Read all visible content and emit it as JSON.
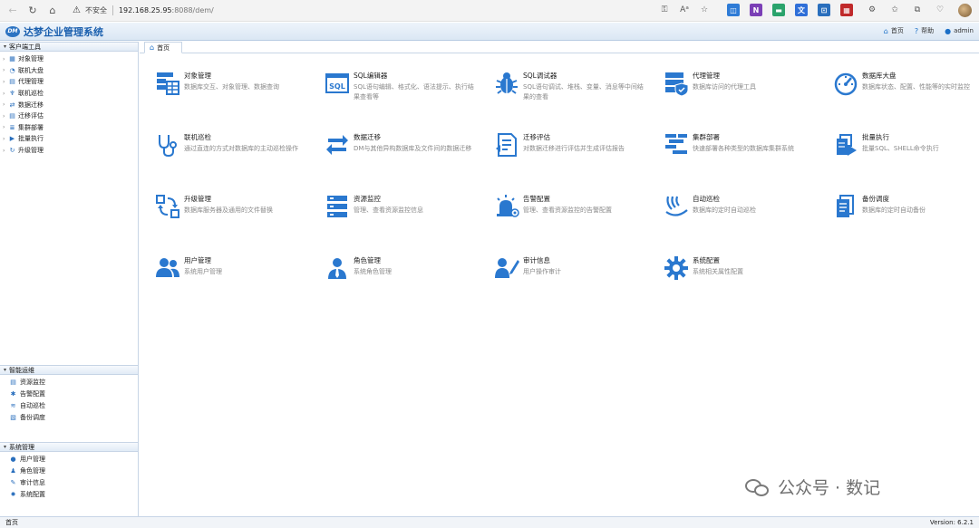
{
  "browser": {
    "insecure_label": "不安全",
    "url_host": "192.168.25.95",
    "url_path": ":8088/dem/",
    "extensions": [
      {
        "name": "screenshot-ext",
        "color": "#2e7bd6",
        "glyph": "◫"
      },
      {
        "name": "onenote-ext",
        "color": "#7b3fb6",
        "glyph": "N"
      },
      {
        "name": "reader-ext",
        "color": "#2aa36b",
        "glyph": "▬"
      },
      {
        "name": "translate-ext",
        "color": "#2f6fd8",
        "glyph": "文"
      },
      {
        "name": "crop-ext",
        "color": "#2a6fbd",
        "glyph": "⊡"
      },
      {
        "name": "pdf-ext",
        "color": "#c0292a",
        "glyph": "▦"
      }
    ]
  },
  "header": {
    "title": "达梦企业管理系统",
    "logo_text": "DM",
    "links": [
      {
        "name": "home",
        "label": "首页",
        "icon": "⌂"
      },
      {
        "name": "help",
        "label": "帮助",
        "icon": "?"
      },
      {
        "name": "user",
        "label": "admin",
        "icon": "●"
      }
    ]
  },
  "sidebar": {
    "panels": [
      {
        "title": "客户端工具",
        "items": [
          {
            "label": "对象管理",
            "icon": "▦"
          },
          {
            "label": "联机大盘",
            "icon": "◔"
          },
          {
            "label": "代理管理",
            "icon": "▤"
          },
          {
            "label": "联机巡检",
            "icon": "♆"
          },
          {
            "label": "数据迁移",
            "icon": "⇄"
          },
          {
            "label": "迁移评估",
            "icon": "▤"
          },
          {
            "label": "集群部署",
            "icon": "≣"
          },
          {
            "label": "批量执行",
            "icon": "▶"
          },
          {
            "label": "升级管理",
            "icon": "↻"
          }
        ]
      },
      {
        "title": "智能运维",
        "items": [
          {
            "label": "资源监控",
            "icon": "▤"
          },
          {
            "label": "告警配置",
            "icon": "✱"
          },
          {
            "label": "自动巡检",
            "icon": "≋"
          },
          {
            "label": "备份调度",
            "icon": "▧"
          }
        ]
      },
      {
        "title": "系统管理",
        "items": [
          {
            "label": "用户管理",
            "icon": "●"
          },
          {
            "label": "角色管理",
            "icon": "♟"
          },
          {
            "label": "审计信息",
            "icon": "✎"
          },
          {
            "label": "系统配置",
            "icon": "✹"
          }
        ]
      }
    ]
  },
  "tab": {
    "label": "首页"
  },
  "cards": [
    {
      "title": "对象管理",
      "desc": "数据库交互、对象管理、数据查询",
      "icon": "object-table"
    },
    {
      "title": "SQL编辑器",
      "desc": "SQL语句编辑、格式化、语法提示、执行结果查看等",
      "icon": "sql"
    },
    {
      "title": "SQL调试器",
      "desc": "SQL语句调试、堆栈、变量、消息等中间结果的查看",
      "icon": "bug"
    },
    {
      "title": "代理管理",
      "desc": "数据库访问的代理工具",
      "icon": "server-shield"
    },
    {
      "title": "数据库大盘",
      "desc": "数据库状态、配置、性能等的实时监控",
      "icon": "gauge"
    },
    {
      "title": "联机巡检",
      "desc": "通过直连的方式对数据库的主动巡检操作",
      "icon": "stethoscope"
    },
    {
      "title": "数据迁移",
      "desc": "DM与其他异构数据库及文件间的数据迁移",
      "icon": "exchange"
    },
    {
      "title": "迁移评估",
      "desc": "对数据迁移进行评估并生成评估报告",
      "icon": "report"
    },
    {
      "title": "集群部署",
      "desc": "快速部署各种类型的数据库集群系统",
      "icon": "cluster"
    },
    {
      "title": "批量执行",
      "desc": "批量SQL、SHELL命令执行",
      "icon": "batch"
    },
    {
      "title": "升级管理",
      "desc": "数据库服务器及通用的文件替换",
      "icon": "upgrade"
    },
    {
      "title": "资源监控",
      "desc": "管理、查看资源监控信息",
      "icon": "resource"
    },
    {
      "title": "告警配置",
      "desc": "管理、查看资源监控的告警配置",
      "icon": "alarm"
    },
    {
      "title": "自动巡检",
      "desc": "数据库的定时自动巡检",
      "icon": "auto-inspect"
    },
    {
      "title": "备份调度",
      "desc": "数据库的定时自动备份",
      "icon": "backup"
    },
    {
      "title": "用户管理",
      "desc": "系统用户管理",
      "icon": "users"
    },
    {
      "title": "角色管理",
      "desc": "系统角色管理",
      "icon": "role"
    },
    {
      "title": "审计信息",
      "desc": "用户操作审计",
      "icon": "audit"
    },
    {
      "title": "系统配置",
      "desc": "系统相关属性配置",
      "icon": "settings"
    }
  ],
  "status": {
    "left": "首页",
    "right": "Version: 6.2.1"
  },
  "watermark": {
    "text": "公众号 · 数记"
  },
  "colors": {
    "accent": "#1b6fc7",
    "icon_blue": "#2a78cf"
  }
}
